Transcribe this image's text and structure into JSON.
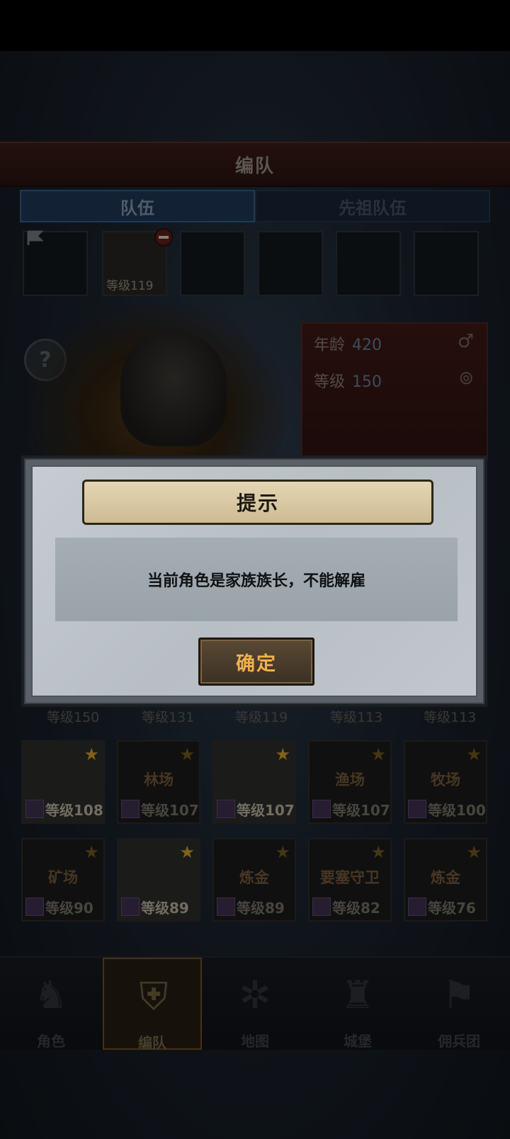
{
  "header": {
    "title": "编队"
  },
  "tabs": [
    {
      "label": "队伍",
      "active": true
    },
    {
      "label": "先祖队伍",
      "active": false
    }
  ],
  "team_slots": [
    {
      "filled": false
    },
    {
      "filled": true,
      "level_text": "等级119"
    },
    {
      "filled": false
    },
    {
      "filled": false
    },
    {
      "filled": false
    },
    {
      "filled": false
    }
  ],
  "stats": {
    "age_label": "年龄",
    "age_value": "420",
    "level_label": "等级",
    "level_value": "150",
    "gender_icon": "male-icon",
    "ring_icon": "ring-icon"
  },
  "roster": {
    "row0_levels": [
      "等级150",
      "等级131",
      "等级119",
      "等级113",
      "等级113"
    ],
    "row1": [
      {
        "job": "",
        "level": "等级108",
        "lit": true
      },
      {
        "job": "林场",
        "level": "等级107",
        "lit": false
      },
      {
        "job": "",
        "level": "等级107",
        "lit": true
      },
      {
        "job": "渔场",
        "level": "等级107",
        "lit": false
      },
      {
        "job": "牧场",
        "level": "等级100",
        "lit": false
      }
    ],
    "row2": [
      {
        "job": "矿场",
        "level": "等级90",
        "lit": false
      },
      {
        "job": "",
        "level": "等级89",
        "lit": true
      },
      {
        "job": "炼金",
        "level": "等级89",
        "lit": false
      },
      {
        "job": "要塞守卫",
        "level": "等级82",
        "lit": false
      },
      {
        "job": "炼金",
        "level": "等级76",
        "lit": false
      }
    ]
  },
  "nav": [
    {
      "label": "角色",
      "icon": "knight-icon",
      "active": false
    },
    {
      "label": "编队",
      "icon": "helmet-icon",
      "active": true
    },
    {
      "label": "地图",
      "icon": "compass-icon",
      "active": false
    },
    {
      "label": "城堡",
      "icon": "castle-icon",
      "active": false
    },
    {
      "label": "佣兵团",
      "icon": "banner-icon",
      "active": false
    }
  ],
  "dialog": {
    "title": "提示",
    "message": "当前角色是家族族长，不能解雇",
    "confirm_label": "确定"
  },
  "colors": {
    "confirm_text": "#f0b24e",
    "banner": "#e4d6b4"
  }
}
